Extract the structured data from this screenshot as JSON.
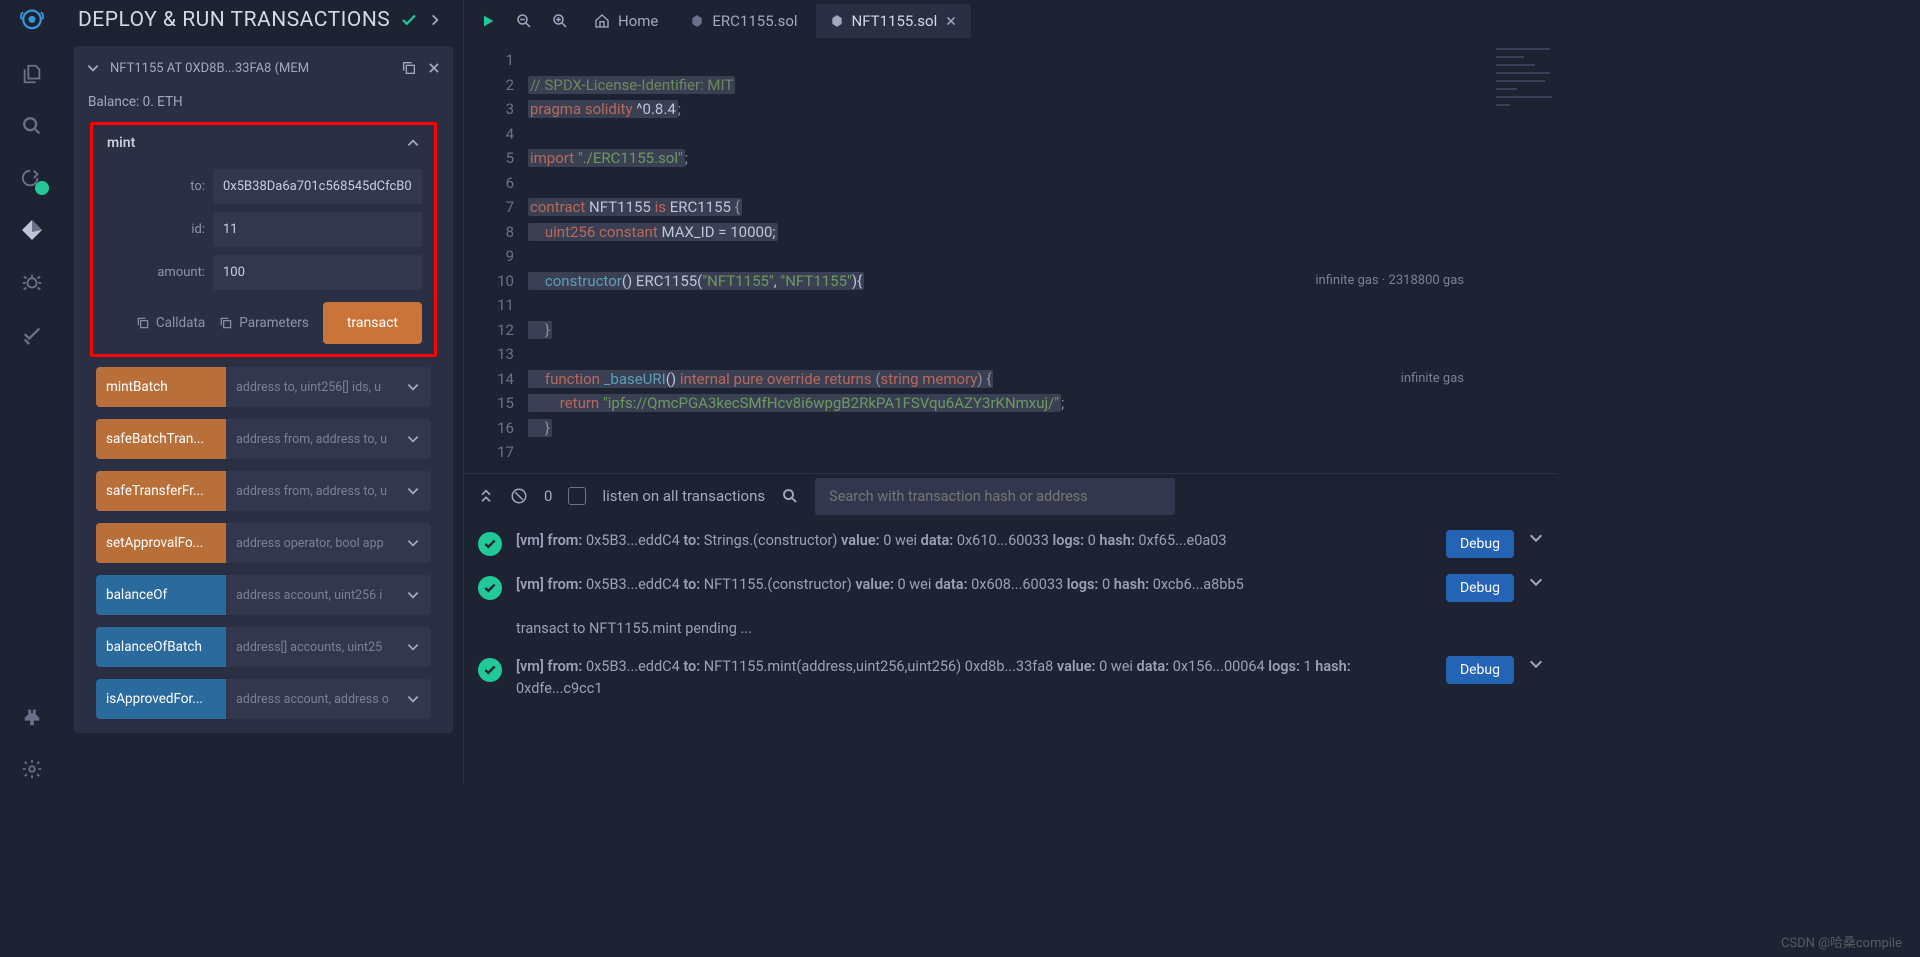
{
  "sidepanel": {
    "title": "DEPLOY & RUN TRANSACTIONS",
    "deployed": {
      "label_full": "NFT1155 AT 0XD8B...33FA8 (MEM",
      "balance": "Balance: 0. ETH"
    },
    "mint": {
      "title": "mint",
      "to_label": "to:",
      "to_value": "0x5B38Da6a701c568545dCfcB0",
      "id_label": "id:",
      "id_value": "11",
      "amount_label": "amount:",
      "amount_value": "100",
      "calldata": "Calldata",
      "parameters": "Parameters",
      "transact": "transact"
    },
    "functions": [
      {
        "name": "mintBatch",
        "params": "address to, uint256[] ids, u",
        "kind": "orange"
      },
      {
        "name": "safeBatchTran...",
        "params": "address from, address to, u",
        "kind": "orange"
      },
      {
        "name": "safeTransferFr...",
        "params": "address from, address to, u",
        "kind": "orange"
      },
      {
        "name": "setApprovalFo...",
        "params": "address operator, bool app",
        "kind": "orange"
      },
      {
        "name": "balanceOf",
        "params": "address account, uint256 i",
        "kind": "blue"
      },
      {
        "name": "balanceOfBatch",
        "params": "address[] accounts, uint25",
        "kind": "blue"
      },
      {
        "name": "isApprovedFor...",
        "params": "address account, address o",
        "kind": "blue"
      }
    ]
  },
  "tabs": {
    "home": "Home",
    "erc": "ERC1155.sol",
    "nft": "NFT1155.sol"
  },
  "code": {
    "l1": "// SPDX-License-Identifier: MIT",
    "l2_pragma": "pragma",
    "l2_sol": "solidity",
    "l2_ver": "^0.8.4",
    "l2_semi": ";",
    "l4_import": "import",
    "l4_str": "\"./ERC1155.sol\"",
    "l4_semi": ";",
    "l7_contract": "contract",
    "l7_name": "NFT1155",
    "l7_is": "is",
    "l7_base": "ERC1155",
    "l7_brace": "{",
    "l8_indent": "    ",
    "l8_type": "uint256",
    "l8_const": "constant",
    "l8_ident": "MAX_ID = 10000;",
    "l10_ctor": "constructor",
    "l10_call": "() ERC1155(",
    "l10_s1": "\"NFT1155\"",
    "l10_comma": ", ",
    "l10_s2": "\"NFT1155\"",
    "l10_close": "){",
    "l10_gas": "infinite gas · 2318800 gas",
    "l12_brace": "}",
    "l14_fn": "function",
    "l14_name": "_baseURI",
    "l14_par": "() ",
    "l14_int": "internal",
    "l14_pure": "pure",
    "l14_ov": "override",
    "l14_ret": "returns",
    "l14_sig": "(",
    "l14_str": "string",
    "l14_mem": "memory",
    "l14_sig2": ") {",
    "l14_gas": "infinite gas",
    "l15_ret": "return",
    "l15_str": "\"ipfs://QmcPGA3kecSMfHcv8i6wpgB2RkPA1FSVqu6AZY3rKNmxuj/\"",
    "l15_semi": ";",
    "l16_brace": "}"
  },
  "term": {
    "count": "0",
    "listen": "listen on all transactions",
    "search": "Search with transaction hash or address",
    "rows": [
      "[vm]  from: 0x5B3...eddC4 to: Strings.(constructor) value: 0 wei data: 0x610...60033 logs: 0 hash: 0xf65...e0a03",
      "[vm]  from: 0x5B3...eddC4 to: NFT1155.(constructor) value: 0 wei data: 0x608...60033 logs: 0 hash: 0xcb6...a8bb5",
      "[vm]  from: 0x5B3...eddC4 to: NFT1155.mint(address,uint256,uint256) 0xd8b...33fa8 value: 0 wei data: 0x156...00064 logs: 1 hash: 0xdfe...c9cc1"
    ],
    "pending": "transact to NFT1155.mint pending ...",
    "debug": "Debug"
  },
  "watermark": "CSDN @哈桑compile"
}
